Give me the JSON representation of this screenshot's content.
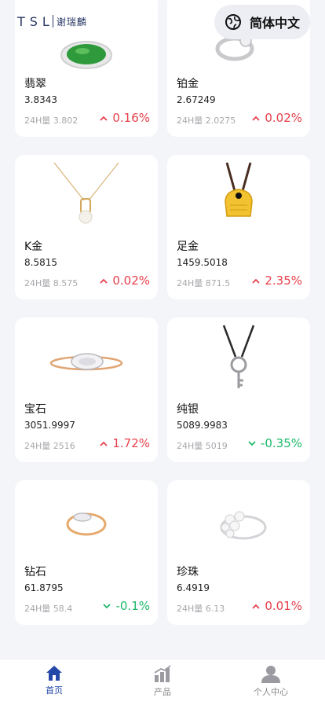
{
  "header": {
    "logo_mark": "TSL",
    "logo_cn": "谢瑞麟",
    "language_label": "简体中文"
  },
  "colors": {
    "up": "#e8404c",
    "down": "#1cb96a",
    "accent": "#2448a8"
  },
  "products": [
    {
      "name": "翡翠",
      "price": "3.8343",
      "volume": "24H量 3.802",
      "change": "0.16%",
      "direction": "up",
      "image": "jade-ring-icon"
    },
    {
      "name": "铂金",
      "price": "2.67249",
      "volume": "24H量 2.0275",
      "change": "0.02%",
      "direction": "up",
      "image": "platinum-ring-icon"
    },
    {
      "name": "K金",
      "price": "8.5815",
      "volume": "24H量 8.575",
      "change": "0.02%",
      "direction": "up",
      "image": "pearl-necklace-icon"
    },
    {
      "name": "足金",
      "price": "1459.5018",
      "volume": "24H量 871.5",
      "change": "2.35%",
      "direction": "up",
      "image": "gold-pendant-icon"
    },
    {
      "name": "宝石",
      "price": "3051.9997",
      "volume": "24H量 2516",
      "change": "1.72%",
      "direction": "up",
      "image": "gem-ring-icon"
    },
    {
      "name": "纯银",
      "price": "5089.9983",
      "volume": "24H量 5019",
      "change": "-0.35%",
      "direction": "down",
      "image": "silver-key-necklace-icon"
    },
    {
      "name": "钻石",
      "price": "61.8795",
      "volume": "24H量 58.4",
      "change": "-0.1%",
      "direction": "down",
      "image": "diamond-ring-icon"
    },
    {
      "name": "珍珠",
      "price": "6.4919",
      "volume": "24H量 6.13",
      "change": "0.01%",
      "direction": "up",
      "image": "pearl-ring-icon"
    }
  ],
  "tabs": [
    {
      "label": "首页",
      "icon": "home-icon",
      "active": true
    },
    {
      "label": "产品",
      "icon": "chart-bars-icon",
      "active": false
    },
    {
      "label": "个人中心",
      "icon": "user-icon",
      "active": false
    }
  ]
}
